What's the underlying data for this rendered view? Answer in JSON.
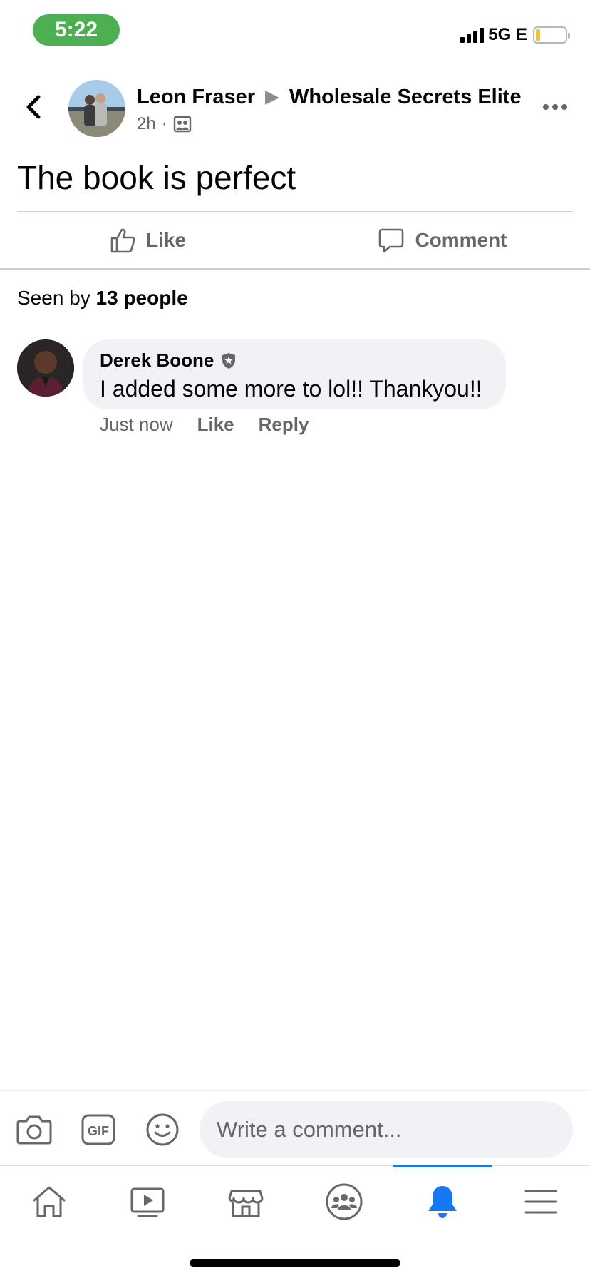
{
  "status_bar": {
    "time": "5:22",
    "network": "5G E",
    "battery_level": 0.15,
    "battery_color": "#f1c232",
    "time_pill_color": "#4cb052"
  },
  "header": {
    "author": "Leon Fraser",
    "group": "Wholesale Secrets Elite",
    "age": "2h",
    "separator": "·",
    "audience_icon": "group-audience-icon"
  },
  "post": {
    "text": "The book is perfect"
  },
  "actions": {
    "like_label": "Like",
    "comment_label": "Comment"
  },
  "seen": {
    "prefix": "Seen by ",
    "count_text": "13 people"
  },
  "comments": [
    {
      "author": "Derek Boone",
      "badge_icon": "shield-star-icon",
      "text": "I added some more to lol!! Thankyou!!",
      "time": "Just now",
      "like_label": "Like",
      "reply_label": "Reply"
    }
  ],
  "composer": {
    "placeholder": "Write a comment...",
    "icons": [
      "camera-icon",
      "gif-icon",
      "emoji-icon"
    ]
  },
  "tab_bar": {
    "tabs": [
      "home",
      "watch",
      "marketplace",
      "groups",
      "notifications",
      "menu"
    ],
    "active": "notifications",
    "accent": "#1877f2"
  }
}
